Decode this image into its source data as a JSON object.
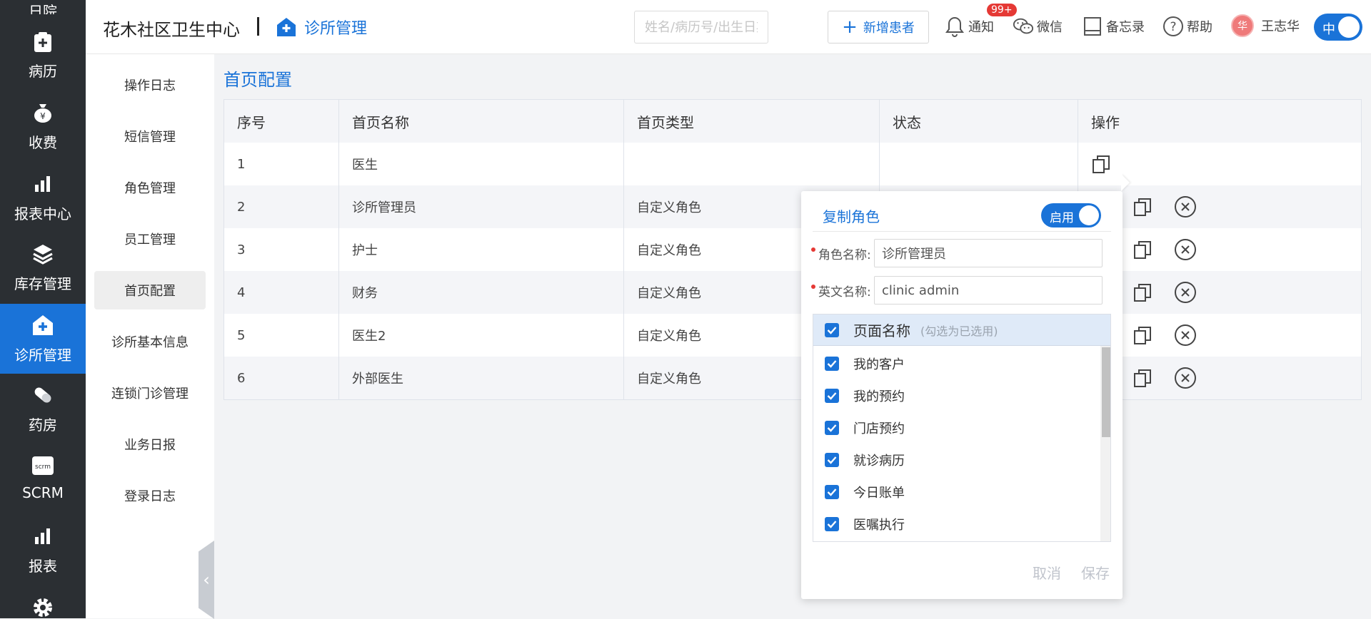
{
  "nav": {
    "items": [
      {
        "label": "日院",
        "icon": "partial-icon"
      },
      {
        "label": "病历",
        "icon": "medical-record-icon"
      },
      {
        "label": "收费",
        "icon": "money-bag-icon"
      },
      {
        "label": "报表中心",
        "icon": "bar-chart-icon"
      },
      {
        "label": "库存管理",
        "icon": "layers-icon"
      },
      {
        "label": "诊所管理",
        "icon": "clinic-plus-icon"
      },
      {
        "label": "药房",
        "icon": "pill-icon"
      },
      {
        "label": "SCRM",
        "icon": "scrm-icon"
      },
      {
        "label": "报表",
        "icon": "bar-chart-icon"
      }
    ]
  },
  "header": {
    "title": "花木社区卫生中心",
    "module": "诊所管理",
    "search_placeholder": "姓名/病历号/出生日期/",
    "new_patient": "新增患者",
    "notify": "通知",
    "badge": "99+",
    "wechat": "微信",
    "memo": "备忘录",
    "help": "帮助",
    "user": "王志华",
    "avatar_char": "华",
    "lang": "中"
  },
  "submenu": {
    "items": [
      "操作日志",
      "短信管理",
      "角色管理",
      "员工管理",
      "首页配置",
      "诊所基本信息",
      "连锁门诊管理",
      "业务日报",
      "登录日志"
    ],
    "active": "首页配置"
  },
  "page": {
    "title": "首页配置",
    "columns": [
      "序号",
      "首页名称",
      "首页类型",
      "状态",
      "操作"
    ],
    "rows": [
      {
        "no": "1",
        "name": "医生",
        "type": "",
        "status": ""
      },
      {
        "no": "2",
        "name": "诊所管理员",
        "type": "自定义角色",
        "status": ""
      },
      {
        "no": "3",
        "name": "护士",
        "type": "自定义角色",
        "status": ""
      },
      {
        "no": "4",
        "name": "财务",
        "type": "自定义角色",
        "status": ""
      },
      {
        "no": "5",
        "name": "医生2",
        "type": "自定义角色",
        "status": ""
      },
      {
        "no": "6",
        "name": "外部医生",
        "type": "自定义角色",
        "status": ""
      }
    ]
  },
  "popover": {
    "title": "复制角色",
    "enable": "启用",
    "role_label": "角色名称:",
    "role_value": "诊所管理员",
    "en_label": "英文名称:",
    "en_value": "clinic admin",
    "list_header": "页面名称",
    "list_hint": "(勾选为已选用)",
    "items": [
      "我的客户",
      "我的预约",
      "门店预约",
      "就诊病历",
      "今日账单",
      "医嘱执行"
    ],
    "cancel": "取消",
    "save": "保存"
  }
}
